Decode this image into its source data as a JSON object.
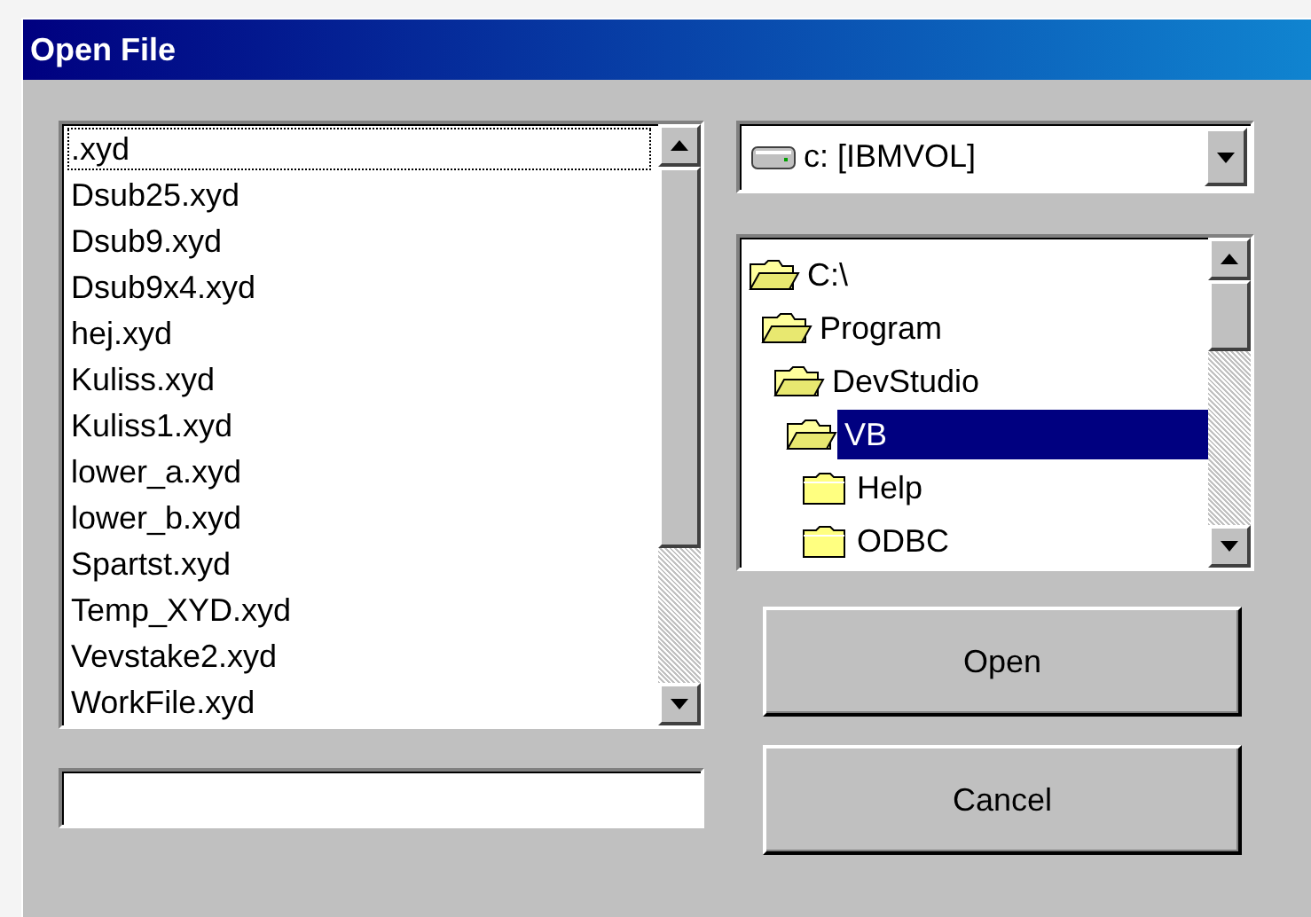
{
  "window": {
    "title": "Open File"
  },
  "files": [
    {
      "name": ".xyd",
      "focused": true
    },
    {
      "name": "Dsub25.xyd",
      "focused": false
    },
    {
      "name": "Dsub9.xyd",
      "focused": false
    },
    {
      "name": "Dsub9x4.xyd",
      "focused": false
    },
    {
      "name": "hej.xyd",
      "focused": false
    },
    {
      "name": "Kuliss.xyd",
      "focused": false
    },
    {
      "name": "Kuliss1.xyd",
      "focused": false
    },
    {
      "name": "lower_a.xyd",
      "focused": false
    },
    {
      "name": "lower_b.xyd",
      "focused": false
    },
    {
      "name": "Spartst.xyd",
      "focused": false
    },
    {
      "name": "Temp_XYD.xyd",
      "focused": false
    },
    {
      "name": "Vevstake2.xyd",
      "focused": false
    },
    {
      "name": "WorkFile.xyd",
      "focused": false
    }
  ],
  "drive": {
    "value": "c: [IBMVOL]"
  },
  "folders": [
    {
      "name": "C:\\",
      "open": true,
      "selected": false,
      "children": [
        {
          "name": "Program",
          "open": true,
          "selected": false,
          "children": [
            {
              "name": "DevStudio",
              "open": true,
              "selected": false,
              "children": [
                {
                  "name": "VB",
                  "open": true,
                  "selected": true,
                  "children": [
                    {
                      "name": "Help",
                      "open": false,
                      "selected": false
                    },
                    {
                      "name": "ODBC",
                      "open": false,
                      "selected": false
                    }
                  ]
                }
              ]
            }
          ]
        }
      ]
    }
  ],
  "buttons": [
    {
      "label": "Open"
    },
    {
      "label": "Cancel"
    }
  ]
}
